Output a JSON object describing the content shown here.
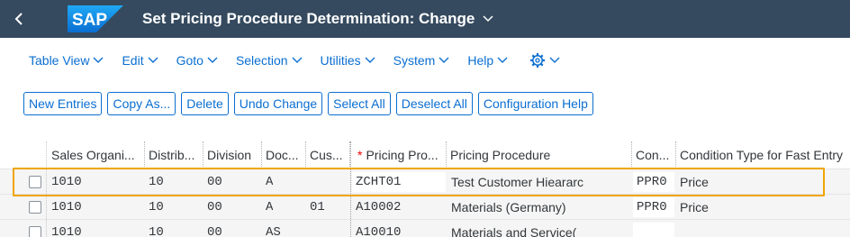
{
  "shell": {
    "back_icon": "chevron-left-icon",
    "logo_text": "SAP",
    "title": "Set Pricing Procedure Determination: Change",
    "title_chevron": "chevron-down-icon"
  },
  "menu": [
    {
      "label": "Table View"
    },
    {
      "label": "Edit"
    },
    {
      "label": "Goto"
    },
    {
      "label": "Selection"
    },
    {
      "label": "Utilities"
    },
    {
      "label": "System"
    },
    {
      "label": "Help"
    }
  ],
  "settings_icon": "gear-icon",
  "toolbar": {
    "new_entries": "New Entries",
    "copy_as": "Copy As...",
    "delete": "Delete",
    "undo_change": "Undo Change",
    "select_all": "Select All",
    "deselect_all": "Deselect All",
    "configuration_help": "Configuration Help"
  },
  "table": {
    "columns": [
      {
        "label": "Sales Organi..."
      },
      {
        "label": "Distrib..."
      },
      {
        "label": "Division"
      },
      {
        "label": "Doc..."
      },
      {
        "label": "Cus..."
      },
      {
        "label": "Pricing Pro...",
        "required": "*"
      },
      {
        "label": "Pricing Procedure"
      },
      {
        "label": "Con..."
      },
      {
        "label": "Condition Type for Fast Entry"
      }
    ],
    "rows": [
      {
        "sales_org": "1010",
        "distrib": "10",
        "division": "00",
        "doc": "A",
        "cus": "",
        "pricing_proc_code": "ZCHT01",
        "pricing_proc": "Test Customer Hieararc",
        "con": "PPR0",
        "cond_type": "Price",
        "highlighted": true
      },
      {
        "sales_org": "1010",
        "distrib": "10",
        "division": "00",
        "doc": "A",
        "cus": "01",
        "pricing_proc_code": "A10002",
        "pricing_proc": "Materials (Germany)",
        "con": "PPR0",
        "cond_type": "Price",
        "highlighted": false
      },
      {
        "sales_org": "1010",
        "distrib": "10",
        "division": "00",
        "doc": "AS",
        "cus": "",
        "pricing_proc_code": "A10010",
        "pricing_proc": "Materials and Service(",
        "con": "",
        "cond_type": "",
        "highlighted": false
      }
    ]
  },
  "colors": {
    "shell_bg": "#354a5f",
    "accent": "#0a6ed1",
    "highlight": "#f0a500",
    "required": "#e00000"
  }
}
